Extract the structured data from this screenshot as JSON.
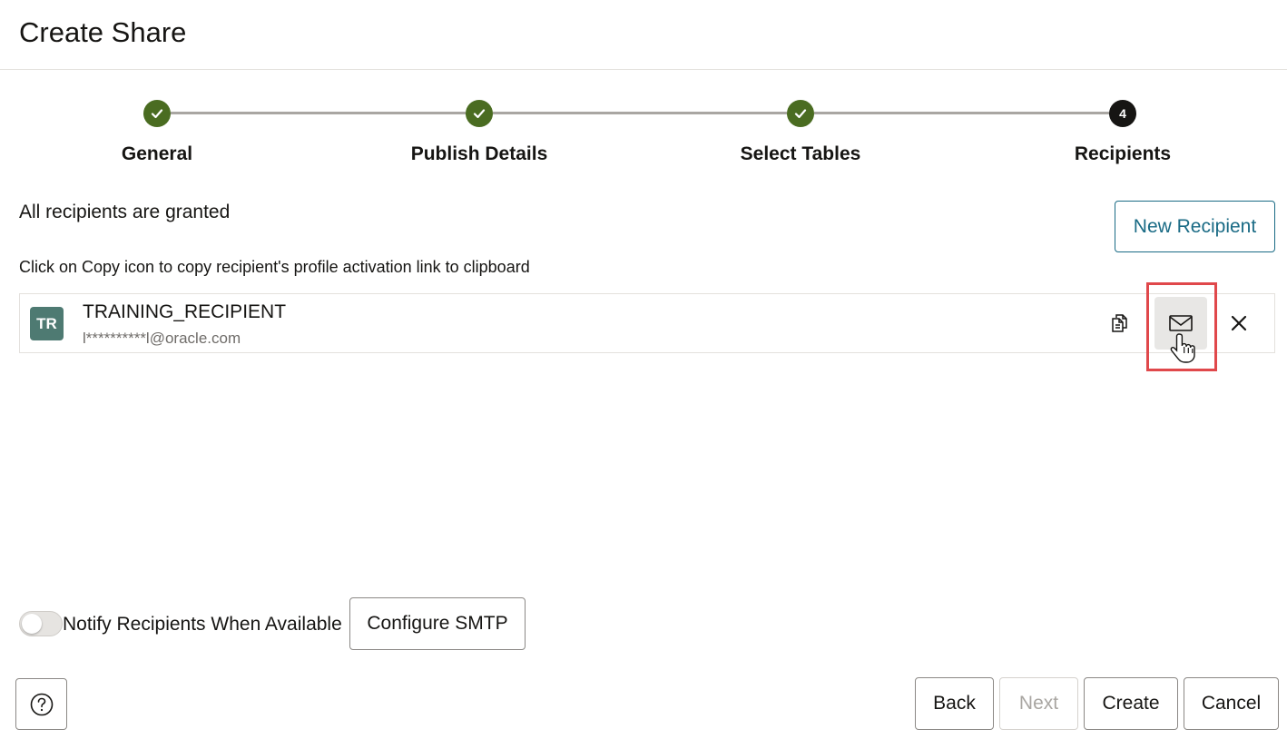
{
  "page": {
    "title": "Create Share"
  },
  "steps": [
    {
      "label": "General",
      "status": "done"
    },
    {
      "label": "Publish Details",
      "status": "done"
    },
    {
      "label": "Select Tables",
      "status": "done"
    },
    {
      "label": "Recipients",
      "status": "current",
      "number": "4"
    }
  ],
  "recipients_section": {
    "granted_text": "All recipients are granted",
    "new_recipient_label": "New Recipient",
    "hint": "Click on Copy icon to copy recipient's profile activation link to clipboard"
  },
  "recipient": {
    "initials": "TR",
    "name": "TRAINING_RECIPIENT",
    "email": "l**********l@oracle.com",
    "icons": [
      "copy-icon",
      "email-icon",
      "close-icon"
    ]
  },
  "notify": {
    "label": "Notify Recipients When Available",
    "enabled": false,
    "configure_smtp_label": "Configure SMTP"
  },
  "footer": {
    "help_icon": "help-icon",
    "back_label": "Back",
    "next_label": "Next",
    "create_label": "Create",
    "cancel_label": "Cancel"
  },
  "colors": {
    "step_done": "#4a6c21",
    "step_current": "#161513",
    "accent": "#1a6b85",
    "highlight": "#e0484b",
    "avatar": "#4e7a72"
  }
}
